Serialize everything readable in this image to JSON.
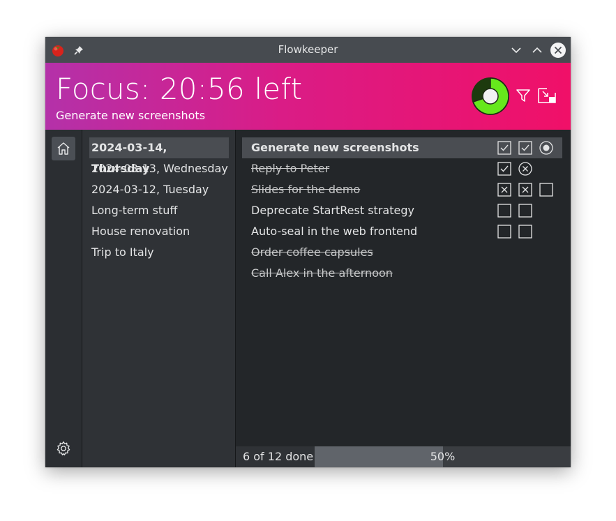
{
  "window": {
    "title": "Flowkeeper"
  },
  "header": {
    "status": "Focus: 20:56 left",
    "current_task": "Generate new screenshots",
    "timer_progress": 0.3,
    "colors": {
      "gradient_start": "#b431a9",
      "gradient_end": "#f01068",
      "timer_ring": "#66e81c"
    }
  },
  "backlogs": [
    {
      "label": "2024-03-14, Thursday",
      "selected": true
    },
    {
      "label": "2024-03-13, Wednesday",
      "selected": false
    },
    {
      "label": "2024-03-12, Tuesday",
      "selected": false
    },
    {
      "label": "Long-term stuff",
      "selected": false
    },
    {
      "label": "House renovation",
      "selected": false
    },
    {
      "label": "Trip to Italy",
      "selected": false
    }
  ],
  "tasks": [
    {
      "title": "Generate new screenshots",
      "done": false,
      "selected": true,
      "pomodoros": [
        "checked",
        "checked",
        "running"
      ]
    },
    {
      "title": "Reply to Peter",
      "done": true,
      "selected": false,
      "pomodoros": [
        "checked",
        "void"
      ]
    },
    {
      "title": "Slides for the demo",
      "done": true,
      "selected": false,
      "pomodoros": [
        "voided",
        "voided",
        "empty"
      ]
    },
    {
      "title": "Deprecate StartRest strategy",
      "done": false,
      "selected": false,
      "pomodoros": [
        "empty",
        "empty"
      ]
    },
    {
      "title": "Auto-seal in the web frontend",
      "done": false,
      "selected": false,
      "pomodoros": [
        "empty",
        "empty"
      ]
    },
    {
      "title": "Order coffee capsules",
      "done": true,
      "selected": false,
      "pomodoros": []
    },
    {
      "title": "Call Alex in the afternoon",
      "done": true,
      "selected": false,
      "pomodoros": []
    }
  ],
  "footer": {
    "done_text": "6 of 12 done",
    "progress_percent": 50,
    "progress_label": "50%"
  },
  "icons": {
    "app": "tomato-icon",
    "pin": "pin-icon",
    "minimize": "chevron-down-icon",
    "maximize": "chevron-up-icon",
    "close": "close-icon",
    "filter": "filter-icon",
    "mini_mode": "mini-mode-icon",
    "home": "home-icon",
    "settings": "gear-icon"
  }
}
